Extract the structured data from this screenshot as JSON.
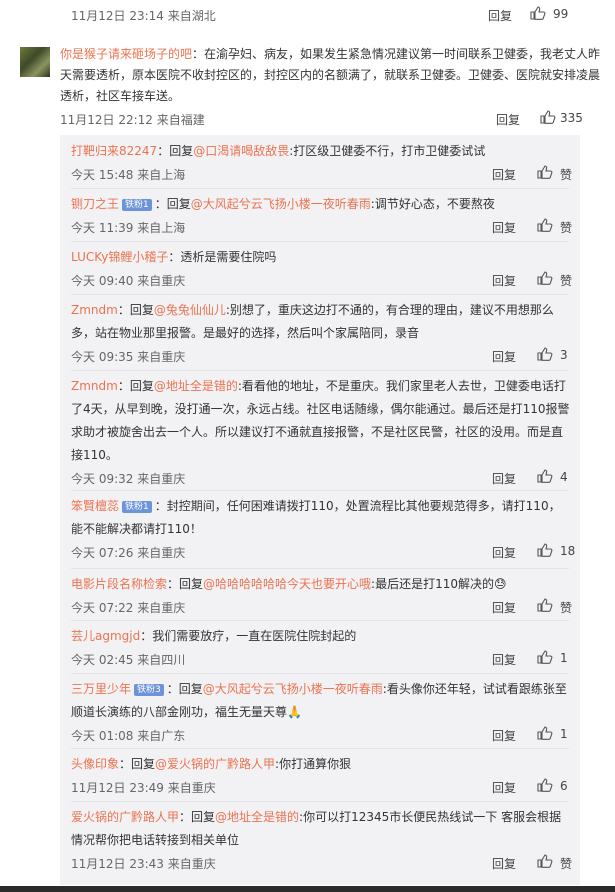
{
  "prev": {
    "meta": "11月12日 23:14 来自湖北",
    "reply": "回复",
    "likes": "99"
  },
  "main": {
    "user": "你是猴子请来砸场子的吧",
    "text": "：在渝孕妇、病友，如果发生紧急情况建议第一时间联系卫健委，我老丈人昨天需要透析，原本医院不收封控区的，封控区内的名额满了，就联系卫健委。卫健委、医院就安排凌晨透析，社区车接车送。",
    "meta": "11月12日 22:12 来自福建",
    "reply": "回复",
    "likes": "335"
  },
  "replies": [
    {
      "user": "打靶归来82247",
      "pre": "：回复",
      "target": "@口渴请喝敌敌畏",
      "text": ":打区级卫健委不行，打市卫健委试试",
      "meta": "今天 15:48 来自上海",
      "reply": "回复",
      "likes": "赞"
    },
    {
      "user": "铡刀之王",
      "badge": "铁粉1",
      "pre": "：回复",
      "target": "@大风起兮云飞扬小楼一夜听春雨",
      "text": ":调节好心态，不要熬夜",
      "meta": "今天 11:39 来自上海",
      "reply": "回复",
      "likes": "赞"
    },
    {
      "user": "LUCKy锦鲤小稽子",
      "pre": "：",
      "target": "",
      "text": "透析是需要住院吗",
      "meta": "今天 09:40 来自重庆",
      "reply": "回复",
      "likes": "赞"
    },
    {
      "user": "Zmndm",
      "pre": "：回复",
      "target": "@兔兔仙仙儿",
      "text": ":别想了，重庆这边打不通的，有合理的理由，建议不用想那么多，站在物业那里报警。是最好的选择，然后叫个家属陪同，录音",
      "meta": "今天 09:35 来自重庆",
      "reply": "回复",
      "likes": "3"
    },
    {
      "user": "Zmndm",
      "pre": "：回复",
      "target": "@地址全是错的",
      "text": ":看看他的地址，不是重庆。我们家里老人去世，卫健委电话打了4天，从早到晚，没打通一次，永远占线。社区电话随缘，偶尔能通过。最后还是打110报警求助才被旋舍出去一个人。所以建议打不通就直接报警，不是社区民警，社区的没用。而是直接110。",
      "meta": "今天 09:32 来自重庆",
      "reply": "回复",
      "likes": "4"
    },
    {
      "user": "笨賢檀蕊",
      "badge": "铁粉1",
      "pre": "：",
      "target": "",
      "text": "封控期间，任何困难请拨打110，处置流程比其他要规范得多，请打110，能不能解决都请打110！",
      "meta": "今天 07:26 来自重庆",
      "reply": "回复",
      "likes": "18"
    },
    {
      "user": "电影片段名称检索",
      "pre": "：回复",
      "target": "@哈哈哈哈哈哈今天也要开心哦",
      "text": ":最后还是打110解决的",
      "emoji": "😓",
      "meta": "今天 07:22 来自重庆",
      "reply": "回复",
      "likes": "赞"
    },
    {
      "user": "芸儿agmgjd",
      "pre": "：",
      "target": "",
      "text": "我们需要放疗，一直在医院住院封起的",
      "meta": "今天 02:45 来自四川",
      "reply": "回复",
      "likes": "1"
    },
    {
      "user": "三万里少年",
      "badge": "铁粉3",
      "pre": "：回复",
      "target": "@大风起兮云飞扬小楼一夜听春雨",
      "text": ":看头像你还年轻，试试看跟练张至顺道长演练的八部金刚功，福生无量天尊",
      "emoji": "🙏",
      "meta": "今天 01:08 来自广东",
      "reply": "回复",
      "likes": "1"
    },
    {
      "user": "头像印象",
      "pre": "：回复",
      "target": "@爱火锅的广黔路人甲",
      "text": ":你打通算你狠",
      "meta": "11月12日 23:49 来自重庆",
      "reply": "回复",
      "likes": "6"
    },
    {
      "user": "爱火锅的广黔路人甲",
      "pre": "：回复",
      "target": "@地址全是错的",
      "text": ":你可以打12345市长便民热线试一下 客服会根据情况帮你把电话转接到相关单位",
      "meta": "11月12日 23:43 来自重庆",
      "reply": "回复",
      "likes": "赞"
    }
  ]
}
